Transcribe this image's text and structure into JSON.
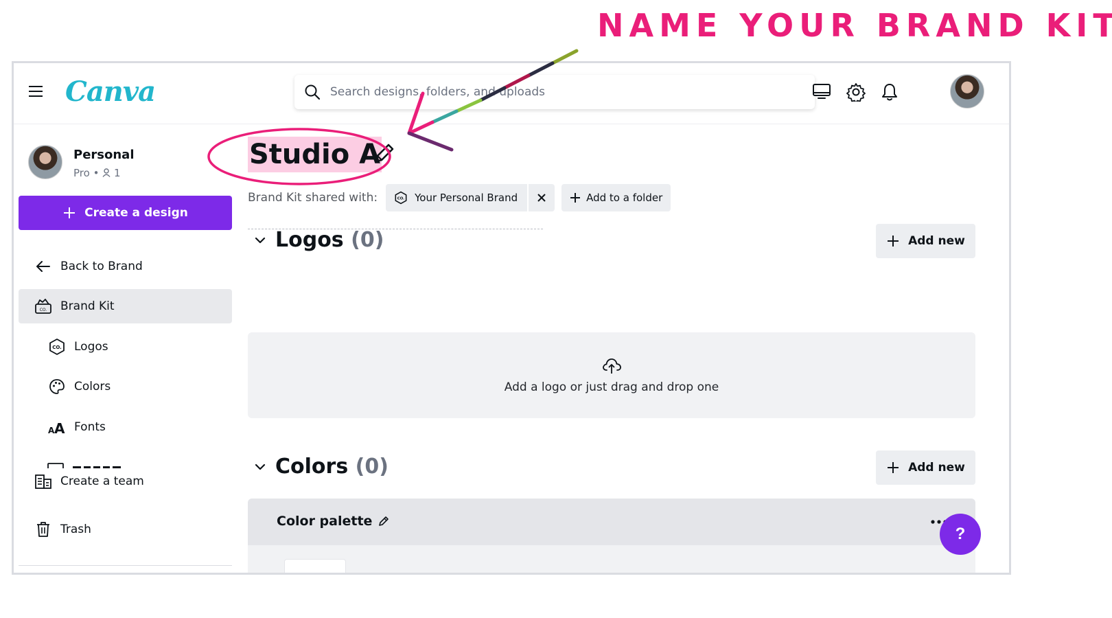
{
  "annotation": {
    "headline": "NAME YOUR BRAND KIT",
    "accent": "#ea1e79"
  },
  "app": {
    "logo": "Canva",
    "brand_color": "#7d2ae8",
    "logo_color": "#22b6cc"
  },
  "header": {
    "search_placeholder": "Search designs, folders, and uploads",
    "icons": [
      "monitor-icon",
      "gear-icon",
      "bell-icon",
      "avatar"
    ]
  },
  "sidebar": {
    "profile_name": "Personal",
    "profile_plan": "Pro",
    "profile_members": "1",
    "create_label": "Create a design",
    "items": [
      {
        "label": "Back to Brand",
        "icon": "arrow-left-icon"
      },
      {
        "label": "Brand Kit",
        "icon": "brand-kit-icon"
      },
      {
        "label": "Logos",
        "icon": "logo-icon"
      },
      {
        "label": "Colors",
        "icon": "palette-icon"
      },
      {
        "label": "Fonts",
        "icon": "fonts-icon"
      },
      {
        "label": "Create a team",
        "icon": "team-icon"
      },
      {
        "label": "Trash",
        "icon": "trash-icon"
      }
    ]
  },
  "main": {
    "kit_title": "Studio A",
    "shared_label": "Brand Kit shared with:",
    "shared_brand": "Your Personal Brand",
    "add_folder_label": "Add to a folder",
    "logos": {
      "title": "Logos",
      "count": "(0)",
      "add_label": "Add new",
      "dropzone_text": "Add a logo or just drag and drop one"
    },
    "colors": {
      "title": "Colors",
      "count": "(0)",
      "add_label": "Add new",
      "palette_title": "Color palette"
    },
    "help_label": "?"
  }
}
